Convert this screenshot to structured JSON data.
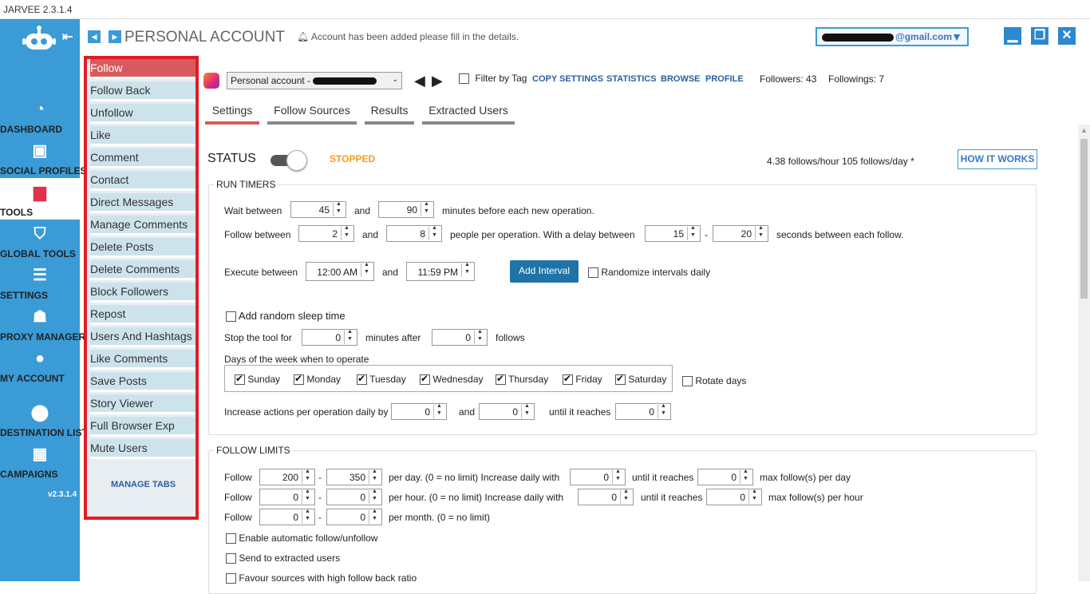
{
  "app": {
    "title": "JARVEE 2.3.1.4",
    "version": "v2.3.1.4"
  },
  "leftnav": {
    "items": [
      {
        "label": "DASHBOARD",
        "icon": "dashboard-icon"
      },
      {
        "label": "SOCIAL PROFILES",
        "icon": "profiles-icon"
      },
      {
        "label": "TOOLS",
        "icon": "tools-icon"
      },
      {
        "label": "GLOBAL TOOLS",
        "icon": "global-tools-icon"
      },
      {
        "label": "SETTINGS",
        "icon": "settings-icon"
      },
      {
        "label": "PROXY MANAGER",
        "icon": "proxy-icon"
      },
      {
        "label": "MY ACCOUNT",
        "icon": "account-icon"
      },
      {
        "label": "DESTINATION LISTS",
        "icon": "pin-icon"
      },
      {
        "label": "CAMPAIGNS",
        "icon": "calendar-icon"
      }
    ]
  },
  "header": {
    "title": "PERSONAL ACCOUNT",
    "notice": "Account has been added please fill in the details.",
    "account_email": "@gmail.com"
  },
  "tabs": {
    "items": [
      "Follow",
      "Follow Back",
      "Unfollow",
      "Like",
      "Comment",
      "Contact",
      "Direct Messages",
      "Manage Comments",
      "Delete Posts",
      "Delete Comments",
      "Block Followers",
      "Repost",
      "Users And Hashtags",
      "Like Comments",
      "Save Posts",
      "Story Viewer",
      "Full Browser Exp",
      "Mute Users"
    ],
    "manage_label": "MANAGE TABS"
  },
  "toolbar": {
    "account_select": "Personal account -",
    "filter_label": "Filter by Tag",
    "links": [
      "COPY SETTINGS",
      "STATISTICS",
      "BROWSE",
      "PROFILE"
    ],
    "followers": "Followers: 43",
    "followings": "Followings: 7"
  },
  "subtabs": [
    "Settings",
    "Follow Sources",
    "Results",
    "Extracted Users"
  ],
  "status": {
    "label": "STATUS",
    "state": "STOPPED",
    "rate": "4.38  follows/hour   105  follows/day *",
    "how_it_works": "HOW IT WORKS"
  },
  "run_timers": {
    "title": "RUN TIMERS",
    "wait_label": "Wait between",
    "wait_min": "45",
    "and": "and",
    "wait_max": "90",
    "wait_suffix": "minutes before each new operation.",
    "follow_label": "Follow between",
    "follow_min": "2",
    "follow_max": "8",
    "follow_mid": "people per operation. With a delay between",
    "delay_min": "15",
    "dash": "-",
    "delay_max": "20",
    "delay_suffix": "seconds between each follow.",
    "exec_label": "Execute between",
    "exec_start": "12:00 AM",
    "exec_end": "11:59 PM",
    "add_interval": "Add Interval",
    "randomize": "Randomize intervals daily",
    "random_sleep": "Add random sleep time",
    "stop_label": "Stop the tool for",
    "stop_minutes": "0",
    "stop_mid": "minutes after",
    "stop_follows": "0",
    "stop_suffix": "follows",
    "days_label": "Days of the week when to operate",
    "days": [
      "Sunday",
      "Monday",
      "Tuesday",
      "Wednesday",
      "Thursday",
      "Friday",
      "Saturday"
    ],
    "rotate_days": "Rotate days",
    "increase_label": "Increase actions per operation daily by",
    "increase_val": "0",
    "increase_and": "and",
    "increase_val2": "0",
    "until_label": "until it reaches",
    "until_val": "0"
  },
  "follow_limits": {
    "title": "FOLLOW LIMITS",
    "rows": [
      {
        "label": "Follow",
        "a": "200",
        "b": "350",
        "text": "per day. (0 = no limit)  Increase daily with",
        "inc": "0",
        "until": "until it reaches",
        "max": "0",
        "suffix": "max follow(s) per day"
      },
      {
        "label": "Follow",
        "a": "0",
        "b": "0",
        "text": "per hour. (0 = no limit)  Increase daily with",
        "inc": "0",
        "until": "until it reaches",
        "max": "0",
        "suffix": "max follow(s) per hour"
      },
      {
        "label": "Follow",
        "a": "0",
        "b": "0",
        "text": "per month. (0 = no limit)"
      }
    ],
    "auto_follow": "Enable automatic follow/unfollow",
    "send_extracted": "Send to extracted users",
    "favour_sources": "Favour sources with high follow back ratio"
  },
  "colors": {
    "nav_bg": "#3a9bd6",
    "active_tab": "#d95a5e",
    "highlight_border": "#e21b23",
    "stopped": "#f39c1f"
  }
}
